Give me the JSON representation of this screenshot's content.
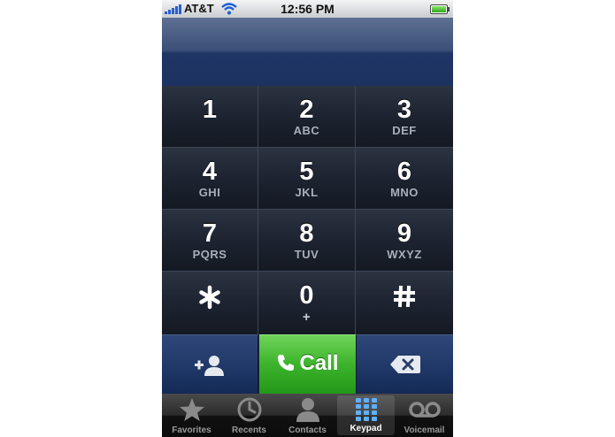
{
  "status_bar": {
    "carrier": "AT&T",
    "time": "12:56 PM"
  },
  "display": {
    "number": ""
  },
  "keypad": {
    "keys": [
      {
        "digit": "1",
        "letters": ""
      },
      {
        "digit": "2",
        "letters": "ABC"
      },
      {
        "digit": "3",
        "letters": "DEF"
      },
      {
        "digit": "4",
        "letters": "GHI"
      },
      {
        "digit": "5",
        "letters": "JKL"
      },
      {
        "digit": "6",
        "letters": "MNO"
      },
      {
        "digit": "7",
        "letters": "PQRS"
      },
      {
        "digit": "8",
        "letters": "TUV"
      },
      {
        "digit": "9",
        "letters": "WXYZ"
      },
      {
        "digit": "0",
        "letters": "+"
      }
    ]
  },
  "actions": {
    "add_contact_icon": "add-contact-icon",
    "call_label": "Call",
    "call_icon": "phone-icon",
    "delete_icon": "backspace-icon"
  },
  "tab_bar": {
    "tabs": [
      {
        "label": "Favorites",
        "icon": "star-icon"
      },
      {
        "label": "Recents",
        "icon": "clock-icon"
      },
      {
        "label": "Contacts",
        "icon": "person-icon"
      },
      {
        "label": "Keypad",
        "icon": "keypad-icon",
        "active": true
      },
      {
        "label": "Voicemail",
        "icon": "voicemail-icon"
      }
    ]
  },
  "colors": {
    "call_green": "#3cb32b",
    "display_blue": "#1f3565",
    "keypad_dark": "#1d2330"
  }
}
